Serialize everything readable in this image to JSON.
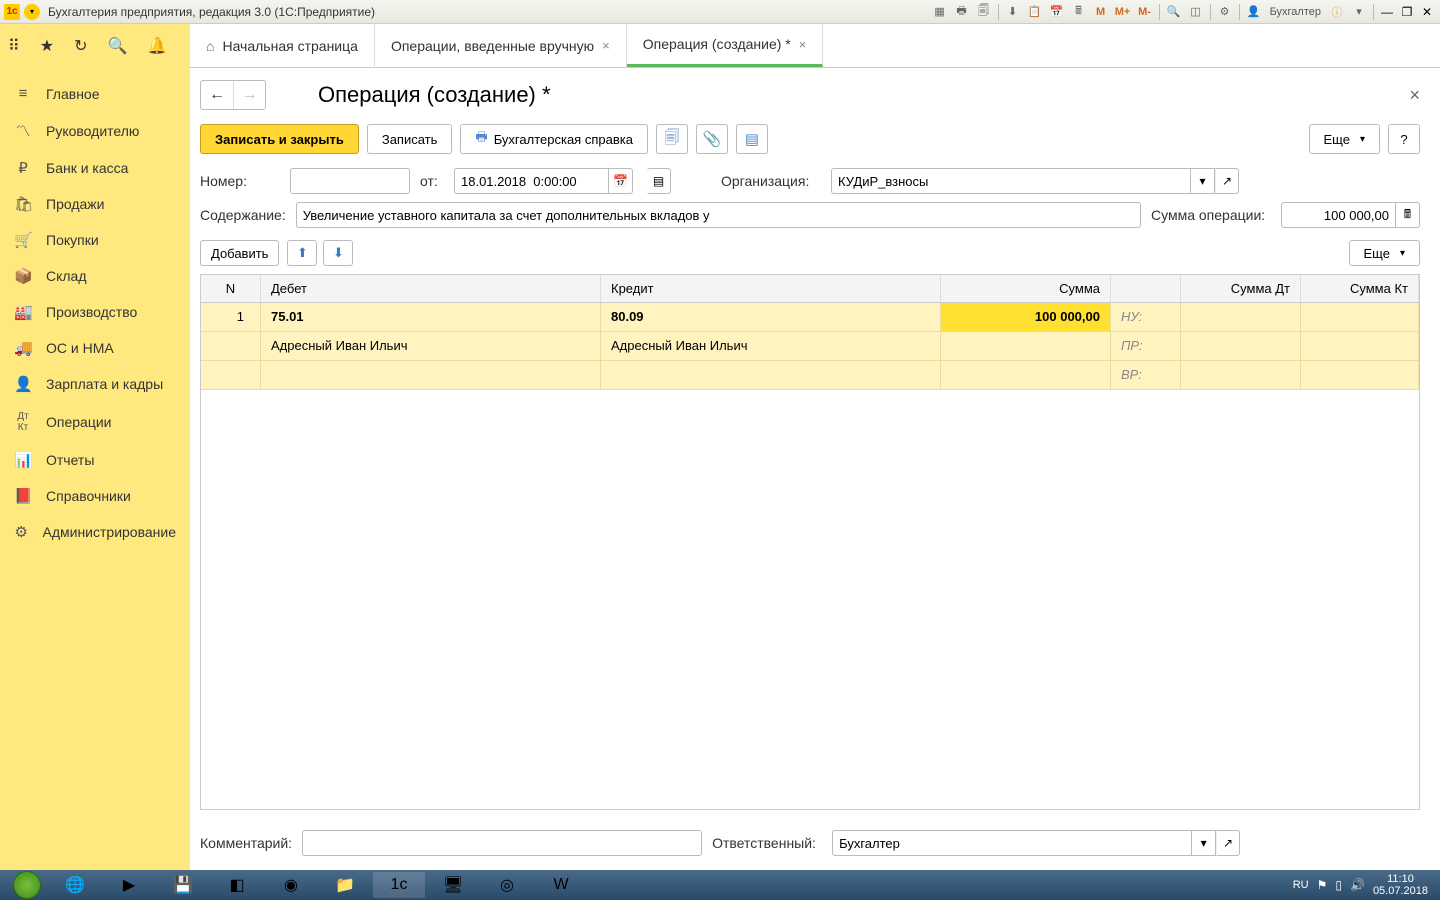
{
  "titlebar": {
    "title": "Бухгалтерия предприятия, редакция 3.0  (1С:Предприятие)",
    "user": "Бухгалтер"
  },
  "sidebar": {
    "items": [
      {
        "icon": "≡",
        "label": "Главное"
      },
      {
        "icon": "📈",
        "label": "Руководителю"
      },
      {
        "icon": "₽",
        "label": "Банк и касса"
      },
      {
        "icon": "🛍",
        "label": "Продажи"
      },
      {
        "icon": "🛒",
        "label": "Покупки"
      },
      {
        "icon": "📦",
        "label": "Склад"
      },
      {
        "icon": "🏭",
        "label": "Производство"
      },
      {
        "icon": "🚚",
        "label": "ОС и НМА"
      },
      {
        "icon": "👤",
        "label": "Зарплата и кадры"
      },
      {
        "icon": "Дт",
        "label": "Операции"
      },
      {
        "icon": "📊",
        "label": "Отчеты"
      },
      {
        "icon": "📕",
        "label": "Справочники"
      },
      {
        "icon": "⚙",
        "label": "Администрирование"
      }
    ]
  },
  "tabs": [
    {
      "label": "Начальная страница",
      "closable": false,
      "home": true
    },
    {
      "label": "Операции, введенные вручную",
      "closable": true
    },
    {
      "label": "Операция (создание) *",
      "closable": true,
      "active": true
    }
  ],
  "page": {
    "title": "Операция (создание) *",
    "buttons": {
      "save_close": "Записать и закрыть",
      "save": "Записать",
      "acc_ref": "Бухгалтерская справка",
      "more": "Еще",
      "help": "?"
    }
  },
  "form": {
    "number_label": "Номер:",
    "number_value": "",
    "from_label": "от:",
    "date_value": "18.01.2018  0:00:00",
    "org_label": "Организация:",
    "org_value": "КУДиР_взносы",
    "content_label": "Содержание:",
    "content_value": "Увеличение уставного капитала за счет дополнительных вкладов у",
    "sum_label": "Сумма операции:",
    "sum_value": "100 000,00",
    "add_button": "Добавить",
    "more_button": "Еще",
    "comment_label": "Комментарий:",
    "comment_value": "",
    "responsible_label": "Ответственный:",
    "responsible_value": "Бухгалтер"
  },
  "grid": {
    "headers": {
      "n": "N",
      "debit": "Дебет",
      "credit": "Кредит",
      "sum": "Сумма",
      "sumdt": "Сумма Дт",
      "sumkt": "Сумма Кт"
    },
    "row": {
      "n": "1",
      "debit_acc": "75.01",
      "credit_acc": "80.09",
      "sum": "100 000,00",
      "debit_subj": "Адресный Иван Ильич",
      "credit_subj": "Адресный Иван Ильич",
      "nu": "НУ:",
      "pr": "ПР:",
      "vr": "ВР:"
    }
  },
  "taskbar": {
    "lang": "RU",
    "time": "11:10",
    "date": "05.07.2018"
  }
}
